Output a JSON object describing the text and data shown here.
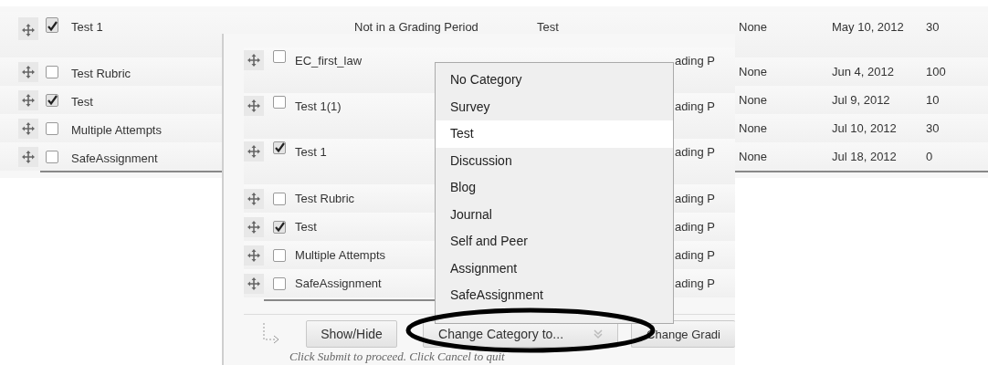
{
  "back_table": {
    "rows": [
      {
        "name": "Test 1",
        "checked": true,
        "column_4": "Not in a Grading Period",
        "column_5": "Test",
        "column_6": "None",
        "column_7": "May 10, 2012",
        "column_8": "30"
      },
      {
        "name": "Test Rubric",
        "checked": false,
        "column_6": "None",
        "column_7": "Jun 4, 2012",
        "column_8": "100"
      },
      {
        "name": "Test",
        "checked": true,
        "column_6": "None",
        "column_7": "Jul 9, 2012",
        "column_8": "10"
      },
      {
        "name": "Multiple Attempts",
        "checked": false,
        "column_6": "None",
        "column_7": "Jul 10, 2012",
        "column_8": "30"
      },
      {
        "name": "SafeAssignment",
        "checked": false,
        "column_6": "None",
        "column_7": "Jul 18, 2012",
        "column_8": "0"
      }
    ]
  },
  "front_panel": {
    "rows": [
      {
        "name": "EC_first_law",
        "checked": false,
        "column_4": "ading P"
      },
      {
        "name": "Test 1(1)",
        "checked": false,
        "column_4": "ading P"
      },
      {
        "name": "Test 1",
        "checked": true,
        "column_4": "ading P"
      },
      {
        "name": "Test Rubric",
        "checked": false,
        "column_4": "ading P"
      },
      {
        "name": "Test",
        "checked": true,
        "column_4": "ading P"
      },
      {
        "name": "Multiple Attempts",
        "checked": false,
        "column_4": "ading P"
      },
      {
        "name": "SafeAssignment",
        "checked": false,
        "column_4": "ading P"
      }
    ],
    "category_menu": {
      "items": [
        {
          "label": "No Category",
          "selected": false
        },
        {
          "label": "Survey",
          "selected": false
        },
        {
          "label": "Test",
          "selected": true
        },
        {
          "label": "Discussion",
          "selected": false
        },
        {
          "label": "Blog",
          "selected": false
        },
        {
          "label": "Journal",
          "selected": false
        },
        {
          "label": "Self and Peer",
          "selected": false
        },
        {
          "label": "Assignment",
          "selected": false
        },
        {
          "label": "SafeAssignment",
          "selected": false
        }
      ]
    },
    "action_bar": {
      "buttons": [
        {
          "label": "Show/Hide",
          "kind": "plain"
        },
        {
          "label": "Change Category to...",
          "kind": "menu"
        },
        {
          "label": "Change Gradi",
          "kind": "plain"
        }
      ]
    },
    "footer_text": "Click Submit to proceed. Click Cancel to quit"
  }
}
